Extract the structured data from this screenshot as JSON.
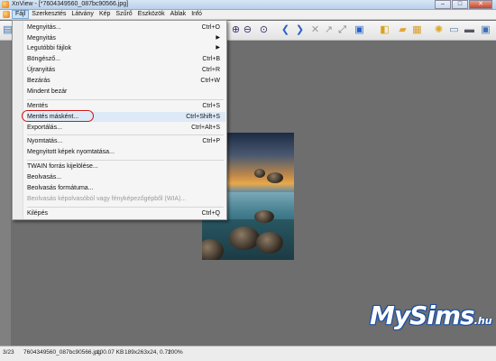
{
  "window": {
    "title": "XnView - [*7604349560_087bc90566.jpg]",
    "min_glyph": "–",
    "max_glyph": "□",
    "close_glyph": "✕"
  },
  "menubar": {
    "items": [
      "Fájl",
      "Szerkesztés",
      "Látvány",
      "Kép",
      "Szűrő",
      "Eszközök",
      "Ablak",
      "Infó"
    ],
    "active_item": "Fájl"
  },
  "toolbar": {
    "icons": [
      "open-icon",
      "zoom-in-icon",
      "zoom-out-icon",
      "prev-icon",
      "next-icon",
      "rotate-icon",
      "crop-icon",
      "palette-icon",
      "copy-icon",
      "folder-icon",
      "paste-icon",
      "settings-icon",
      "print-icon",
      "scan-icon",
      "monitor-icon"
    ]
  },
  "file_menu": {
    "items": [
      {
        "label": "Megnyitás...",
        "shortcut": "Ctrl+O"
      },
      {
        "label": "Megnyitás",
        "shortcut": "",
        "submenu": true
      },
      {
        "label": "Legutóbbi fájlok",
        "shortcut": "",
        "submenu": true
      },
      {
        "label": "Böngésző...",
        "shortcut": "Ctrl+B"
      },
      {
        "label": "Újranyitás",
        "shortcut": "Ctrl+R"
      },
      {
        "label": "Bezárás",
        "shortcut": "Ctrl+W"
      },
      {
        "label": "Mindent bezár",
        "shortcut": ""
      },
      {
        "label": "Mentés",
        "shortcut": "Ctrl+S"
      },
      {
        "label": "Mentés másként...",
        "shortcut": "Ctrl+Shift+S",
        "highlighted": true
      },
      {
        "label": "Exportálás...",
        "shortcut": "Ctrl+Alt+S"
      },
      {
        "label": "Nyomtatás...",
        "shortcut": "Ctrl+P"
      },
      {
        "label": "Megnyitott képek nyomtatása...",
        "shortcut": ""
      },
      {
        "label": "TWAIN forrás kijelölése...",
        "shortcut": ""
      },
      {
        "label": "Beolvasás...",
        "shortcut": ""
      },
      {
        "label": "Beolvasás formátuma...",
        "shortcut": ""
      },
      {
        "label": "Beolvasás képolvasóból vagy fényképezőgépből (WIA)...",
        "shortcut": "",
        "disabled": true
      },
      {
        "label": "Kilépés",
        "shortcut": "Ctrl+Q"
      }
    ],
    "submenu_glyph": "▶"
  },
  "statusbar": {
    "position": "3/23",
    "filename": "7604349560_087bc90566.jpg",
    "filesize": "100.07 KB",
    "dimensions": "189x263x24, 0.72",
    "zoom": "100%"
  },
  "watermark": {
    "brand": "MySims",
    "suffix": ".hu"
  },
  "colors": {
    "highlight_ring": "#d21414",
    "viewer_bg": "#6e6e6e",
    "watermark_outline": "#1a4fa6"
  }
}
